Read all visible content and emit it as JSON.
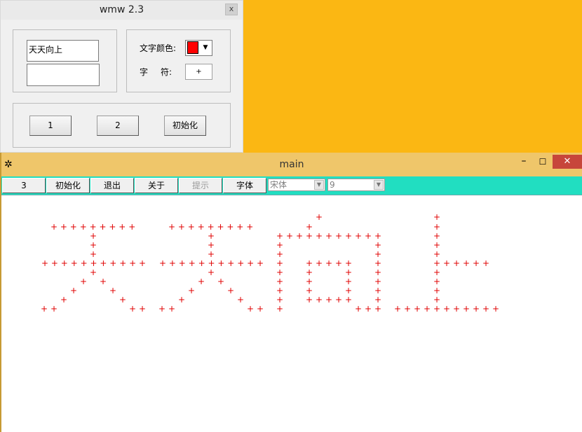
{
  "small_window": {
    "title": "wmw 2.3",
    "close_label": "x",
    "text_input_value": "天天向上",
    "text_input2_value": "",
    "color_label": "文字颜色:",
    "char_label_a": "字",
    "char_label_b": "符:",
    "char_value": "+",
    "color_value": "#FF0000",
    "buttons": [
      "1",
      "2",
      "初始化"
    ]
  },
  "main_window": {
    "title": "main",
    "toolbar": {
      "buttons": [
        "3",
        "初始化",
        "退出",
        "关于",
        "提示",
        "字体"
      ],
      "font_combo": "宋体",
      "size_combo": "9"
    },
    "canvas_char": "+",
    "canvas_text": "天天向上",
    "char_color": "#E00000"
  }
}
